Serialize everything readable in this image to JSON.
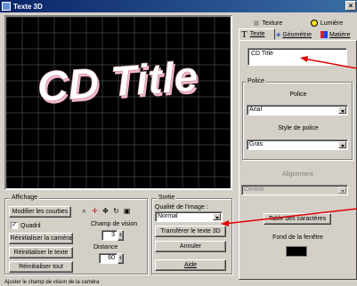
{
  "window": {
    "title": "Texte 3D",
    "close_label": "×"
  },
  "preview": {
    "text": "CD Title",
    "text_color": "#ffffff",
    "shadow_color": "#f2b4c8",
    "grid_color": "#808080"
  },
  "affichage": {
    "label": "Affichage",
    "modify_curves": "Modifier les courbes",
    "grid_checked": "✓",
    "grid_label": "Quadril",
    "reset_camera": "Réinitialiser la caméra",
    "reset_text": "Réinitialiser le texte",
    "reset_all": "Réinitialiser tout",
    "field_of_view_label": "Champ de vision",
    "field_of_view_value": "3",
    "distance_label": "Distance",
    "distance_value": "60"
  },
  "sortie": {
    "label": "Sortie",
    "quality_label": "Qualité de l'image :",
    "quality_value": "Normal",
    "transfer": "Transférer le texte 3D",
    "cancel": "Annuler",
    "help": "Aide"
  },
  "tabs": {
    "texture": "Texture",
    "lumiere": "Lumière",
    "texte": "Texte",
    "geometrie": "Géométrie",
    "matiere": "Matière"
  },
  "text_panel": {
    "input_value": "CD Title",
    "police_group": "Police",
    "police_label": "Police",
    "font_value": "Arial",
    "style_label": "Style de police",
    "style_value": "Gras",
    "alignment_label": "Alignement",
    "alignment_value": "Centrer",
    "char_table": "Table des caractères",
    "window_bg_label": "Fond de la fenêtre",
    "window_bg_color": "#000000"
  },
  "status": {
    "text": "Ajuster le champ de vision de la caméra"
  },
  "annotations": {
    "arrow_color": "#e00000"
  }
}
